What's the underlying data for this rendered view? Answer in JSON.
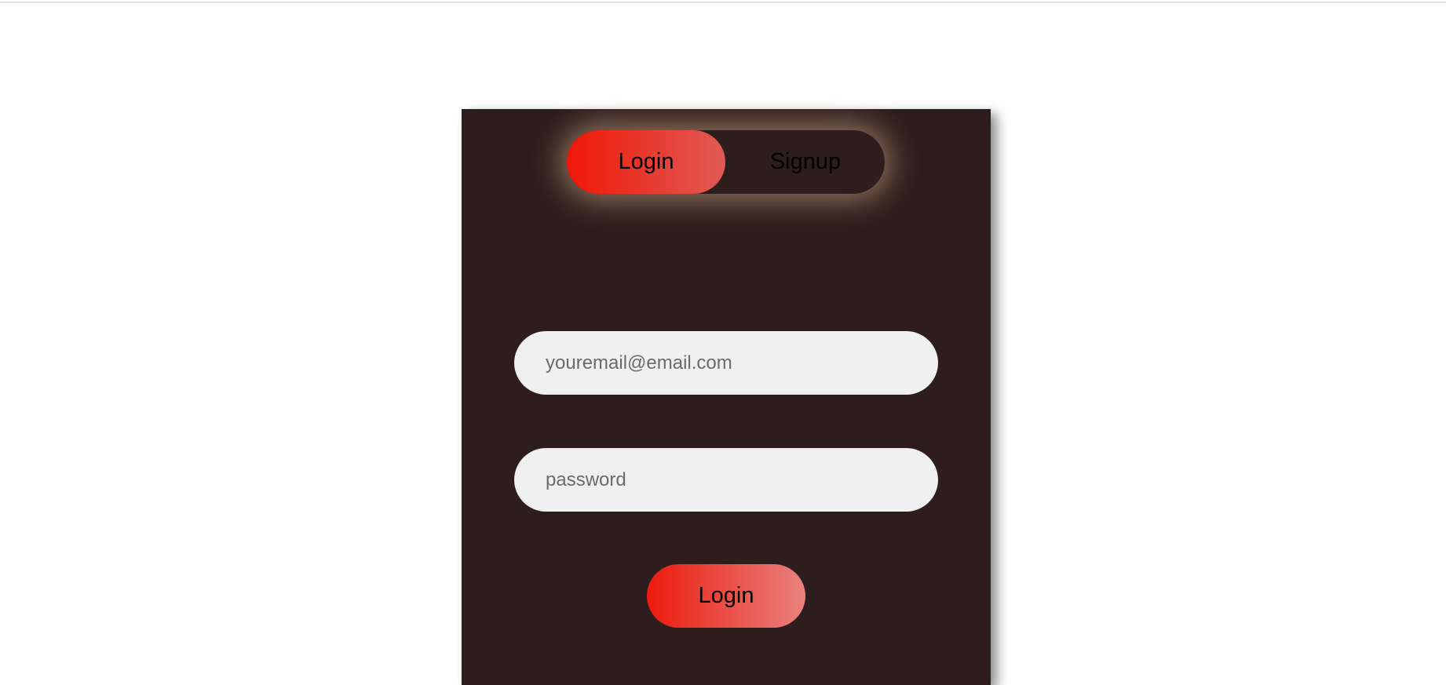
{
  "toggle": {
    "login_label": "Login",
    "signup_label": "Signup",
    "active": "Login"
  },
  "form": {
    "email_placeholder": "youremail@email.com",
    "email_value": "",
    "password_placeholder": "password",
    "password_value": "",
    "submit_label": "Login"
  },
  "colors": {
    "panel_background": "#2d1d1c",
    "accent_start": "#f01707",
    "accent_end": "#e9827d",
    "input_background": "#f0f0f0",
    "glow": "#e6be96"
  }
}
